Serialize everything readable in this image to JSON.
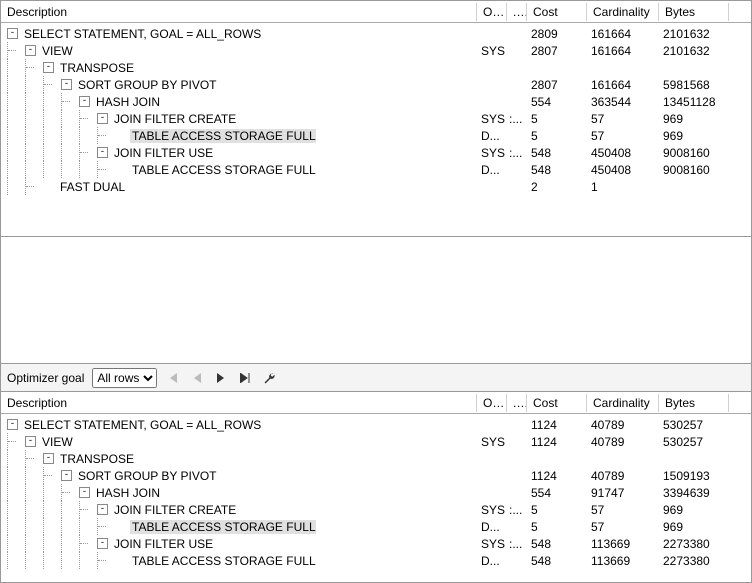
{
  "columns": {
    "description": "Description",
    "o": "O...",
    "x": "...",
    "cost": "Cost",
    "cardinality": "Cardinality",
    "bytes": "Bytes"
  },
  "toolbar": {
    "label": "Optimizer goal",
    "selected": "All rows",
    "options": [
      "All rows"
    ]
  },
  "top_rows": [
    {
      "depth": 0,
      "toggle": "-",
      "label": "SELECT STATEMENT, GOAL = ALL_ROWS",
      "o": "",
      "x": "",
      "cost": "2809",
      "card": "161664",
      "bytes": "2101632",
      "hl": false
    },
    {
      "depth": 1,
      "toggle": "-",
      "label": "VIEW",
      "o": "SYS",
      "x": "",
      "cost": "2807",
      "card": "161664",
      "bytes": "2101632",
      "hl": false
    },
    {
      "depth": 2,
      "toggle": "-",
      "label": "TRANSPOSE",
      "o": "",
      "x": "",
      "cost": "",
      "card": "",
      "bytes": "",
      "hl": false
    },
    {
      "depth": 3,
      "toggle": "-",
      "label": "SORT GROUP BY PIVOT",
      "o": "",
      "x": "",
      "cost": "2807",
      "card": "161664",
      "bytes": "5981568",
      "hl": false
    },
    {
      "depth": 4,
      "toggle": "-",
      "label": "HASH JOIN",
      "o": "",
      "x": "",
      "cost": "554",
      "card": "363544",
      "bytes": "13451128",
      "hl": false
    },
    {
      "depth": 5,
      "toggle": "-",
      "label": "JOIN FILTER CREATE",
      "o": "SYS",
      "x": ":...",
      "cost": "5",
      "card": "57",
      "bytes": "969",
      "hl": false
    },
    {
      "depth": 6,
      "toggle": "",
      "label": "TABLE ACCESS STORAGE FULL",
      "o": "D...",
      "x": "",
      "cost": "5",
      "card": "57",
      "bytes": "969",
      "hl": true
    },
    {
      "depth": 5,
      "toggle": "-",
      "label": "JOIN FILTER USE",
      "o": "SYS",
      "x": ":...",
      "cost": "548",
      "card": "450408",
      "bytes": "9008160",
      "hl": false
    },
    {
      "depth": 6,
      "toggle": "",
      "label": "TABLE ACCESS STORAGE FULL",
      "o": "D...",
      "x": "",
      "cost": "548",
      "card": "450408",
      "bytes": "9008160",
      "hl": false
    },
    {
      "depth": 2,
      "toggle": "",
      "label": "FAST DUAL",
      "o": "",
      "x": "",
      "cost": "2",
      "card": "1",
      "bytes": "",
      "hl": false
    }
  ],
  "bottom_rows": [
    {
      "depth": 0,
      "toggle": "-",
      "label": "SELECT STATEMENT, GOAL = ALL_ROWS",
      "o": "",
      "x": "",
      "cost": "1124",
      "card": "40789",
      "bytes": "530257",
      "hl": false
    },
    {
      "depth": 1,
      "toggle": "-",
      "label": "VIEW",
      "o": "SYS",
      "x": "",
      "cost": "1124",
      "card": "40789",
      "bytes": "530257",
      "hl": false
    },
    {
      "depth": 2,
      "toggle": "-",
      "label": "TRANSPOSE",
      "o": "",
      "x": "",
      "cost": "",
      "card": "",
      "bytes": "",
      "hl": false
    },
    {
      "depth": 3,
      "toggle": "-",
      "label": "SORT GROUP BY PIVOT",
      "o": "",
      "x": "",
      "cost": "1124",
      "card": "40789",
      "bytes": "1509193",
      "hl": false
    },
    {
      "depth": 4,
      "toggle": "-",
      "label": "HASH JOIN",
      "o": "",
      "x": "",
      "cost": "554",
      "card": "91747",
      "bytes": "3394639",
      "hl": false
    },
    {
      "depth": 5,
      "toggle": "-",
      "label": "JOIN FILTER CREATE",
      "o": "SYS",
      "x": ":...",
      "cost": "5",
      "card": "57",
      "bytes": "969",
      "hl": false
    },
    {
      "depth": 6,
      "toggle": "",
      "label": "TABLE ACCESS STORAGE FULL",
      "o": "D...",
      "x": "",
      "cost": "5",
      "card": "57",
      "bytes": "969",
      "hl": true
    },
    {
      "depth": 5,
      "toggle": "-",
      "label": "JOIN FILTER USE",
      "o": "SYS",
      "x": ":...",
      "cost": "548",
      "card": "113669",
      "bytes": "2273380",
      "hl": false
    },
    {
      "depth": 6,
      "toggle": "",
      "label": "TABLE ACCESS STORAGE FULL",
      "o": "D...",
      "x": "",
      "cost": "548",
      "card": "113669",
      "bytes": "2273380",
      "hl": false
    }
  ]
}
